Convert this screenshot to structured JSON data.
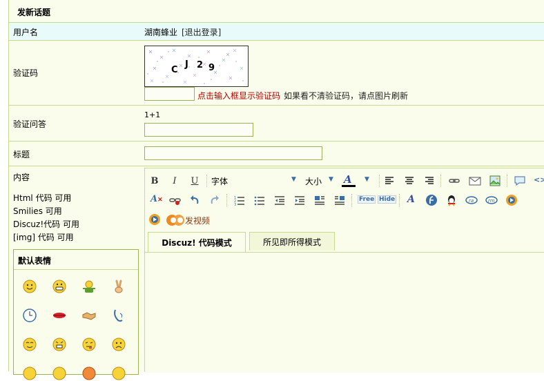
{
  "header": {
    "title": "发新话题"
  },
  "user": {
    "label": "用户名",
    "name": "湖南蜂业",
    "logout": "[退出登录]"
  },
  "captcha": {
    "label": "验证码",
    "chars": [
      "C",
      "J",
      "2",
      "9"
    ],
    "input_value": "",
    "hint": "点击输入框显示验证码",
    "help": "如果看不清验证码，请点图片刷新"
  },
  "qa": {
    "label": "验证问答",
    "question": "1+1",
    "input_value": ""
  },
  "subject": {
    "label": "标题",
    "input_value": ""
  },
  "content": {
    "label": "内容",
    "info": [
      "Html 代码  可用",
      "Smilies 可用",
      "Discuz!代码  可用",
      "[img] 代码  可用"
    ],
    "smilies_title": "默认表情"
  },
  "editor": {
    "bold": "B",
    "italic": "I",
    "underline": "U",
    "font_label": "字体",
    "size_label": "大小",
    "color_glyph": "A",
    "video_label": "发视频",
    "tab_code": "Discuz! 代码模式",
    "tab_wysiwyg": "所见即所得模式",
    "free_label": "Free",
    "hide_label": "Hide"
  },
  "colors": {
    "accent_red": "#b00000",
    "border": "#c6db8d",
    "cyan_row": "#e8fbfa",
    "bg": "#fafdeb"
  }
}
